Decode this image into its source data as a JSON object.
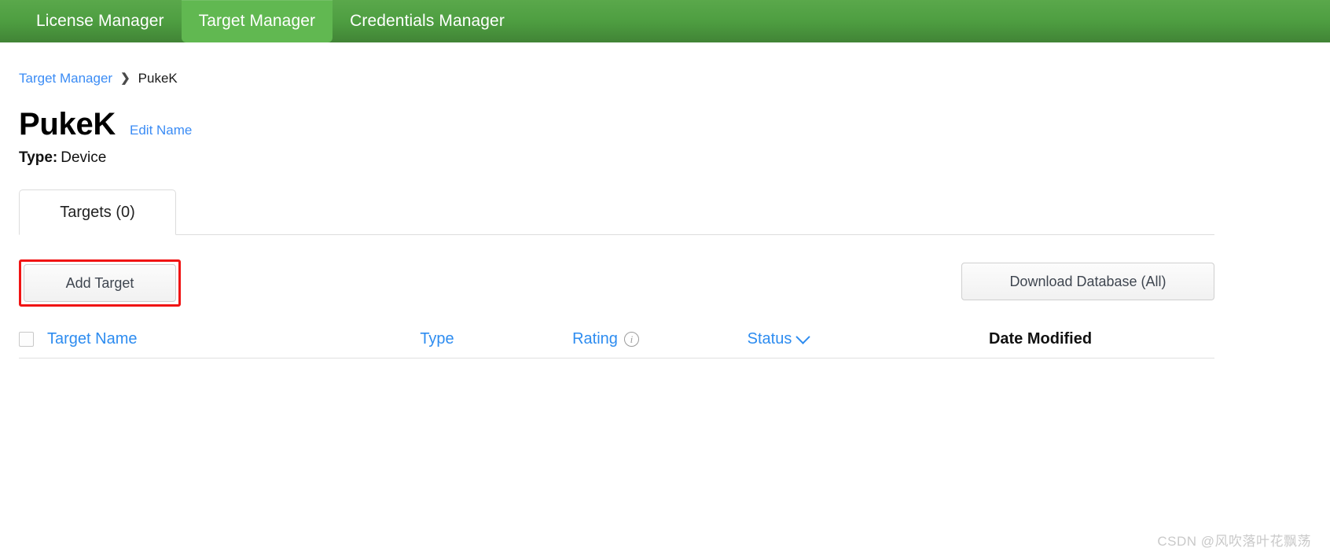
{
  "topnav": {
    "tabs": [
      {
        "label": "License Manager",
        "active": false
      },
      {
        "label": "Target Manager",
        "active": true
      },
      {
        "label": "Credentials Manager",
        "active": false
      }
    ],
    "active_bg": "#61b851",
    "bar_bg": "#4e9e41"
  },
  "breadcrumb": {
    "parent": "Target Manager",
    "separator": "❯",
    "current": "PukeK"
  },
  "header": {
    "title": "PukeK",
    "edit_link": "Edit Name",
    "type_label": "Type:",
    "type_value": "Device"
  },
  "tabs": {
    "items": [
      {
        "label": "Targets (0)",
        "active": true
      }
    ]
  },
  "toolbar": {
    "add_target_label": "Add Target",
    "download_label": "Download Database (All)",
    "highlight_color": "#f01414"
  },
  "table": {
    "columns": [
      {
        "key": "name",
        "label": "Target Name",
        "sortable": true,
        "icon": null,
        "accent": true
      },
      {
        "key": "type",
        "label": "Type",
        "sortable": true,
        "icon": null,
        "accent": true
      },
      {
        "key": "rating",
        "label": "Rating",
        "sortable": true,
        "icon": "info-icon",
        "accent": true
      },
      {
        "key": "status",
        "label": "Status",
        "sortable": true,
        "icon": "chevron-down-icon",
        "accent": true
      },
      {
        "key": "date",
        "label": "Date Modified",
        "sortable": false,
        "icon": null,
        "accent": false
      }
    ],
    "rows": [],
    "link_color": "#2d8cf0"
  },
  "watermark": {
    "text": "CSDN @风吹落叶花飘荡"
  }
}
